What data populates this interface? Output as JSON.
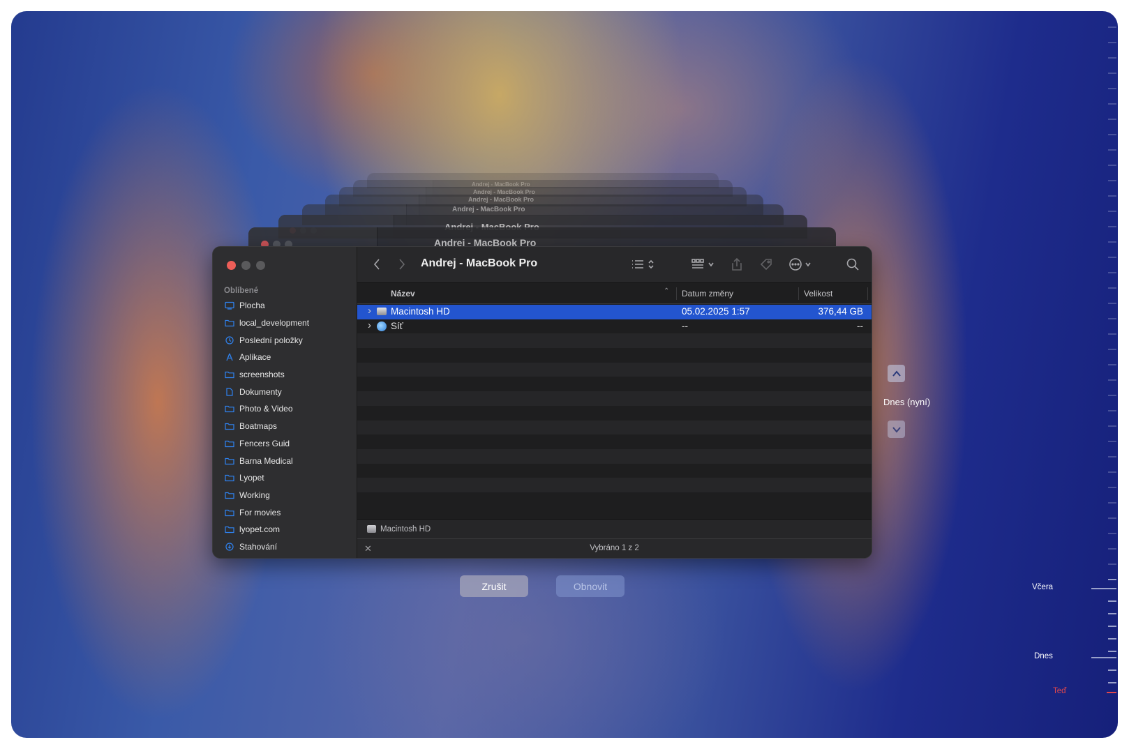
{
  "window": {
    "title": "Andrej - MacBook Pro"
  },
  "sidebar": {
    "section_label": "Oblíbené",
    "items": [
      {
        "label": "Plocha",
        "icon": "desktop-icon"
      },
      {
        "label": "local_development",
        "icon": "folder-icon"
      },
      {
        "label": "Poslední položky",
        "icon": "clock-icon"
      },
      {
        "label": "Aplikace",
        "icon": "applications-icon"
      },
      {
        "label": "screenshots",
        "icon": "folder-icon"
      },
      {
        "label": "Dokumenty",
        "icon": "document-icon"
      },
      {
        "label": "Photo & Video",
        "icon": "folder-icon"
      },
      {
        "label": "Boatmaps",
        "icon": "folder-icon"
      },
      {
        "label": "Fencers Guid",
        "icon": "folder-icon"
      },
      {
        "label": "Barna Medical",
        "icon": "folder-icon"
      },
      {
        "label": "Lyopet",
        "icon": "folder-icon"
      },
      {
        "label": "Working",
        "icon": "folder-icon"
      },
      {
        "label": "For movies",
        "icon": "folder-icon"
      },
      {
        "label": "lyopet.com",
        "icon": "folder-icon"
      },
      {
        "label": "Stahování",
        "icon": "download-icon"
      }
    ]
  },
  "columns": {
    "name": "Název",
    "date": "Datum změny",
    "size": "Velikost"
  },
  "files": [
    {
      "name": "Macintosh HD",
      "date": "05.02.2025 1:57",
      "size": "376,44 GB",
      "selected": true,
      "icon": "hard-drive-icon"
    },
    {
      "name": "Síť",
      "date": "--",
      "size": "--",
      "selected": false,
      "icon": "network-globe-icon"
    }
  ],
  "pathbar": {
    "label": "Macintosh HD"
  },
  "status": {
    "text": "Vybráno 1 z 2"
  },
  "buttons": {
    "cancel": "Zrušit",
    "restore": "Obnovit"
  },
  "time_machine": {
    "current": "Dnes (nyní)",
    "timeline": {
      "yesterday": "Včera",
      "today": "Dnes",
      "now": "Teď"
    }
  },
  "colors": {
    "accent": "#2355cf",
    "now_marker": "#e0474c",
    "close": "#ed5e58",
    "minimize": "#5a5a5c",
    "zoom": "#5a5a5c"
  }
}
